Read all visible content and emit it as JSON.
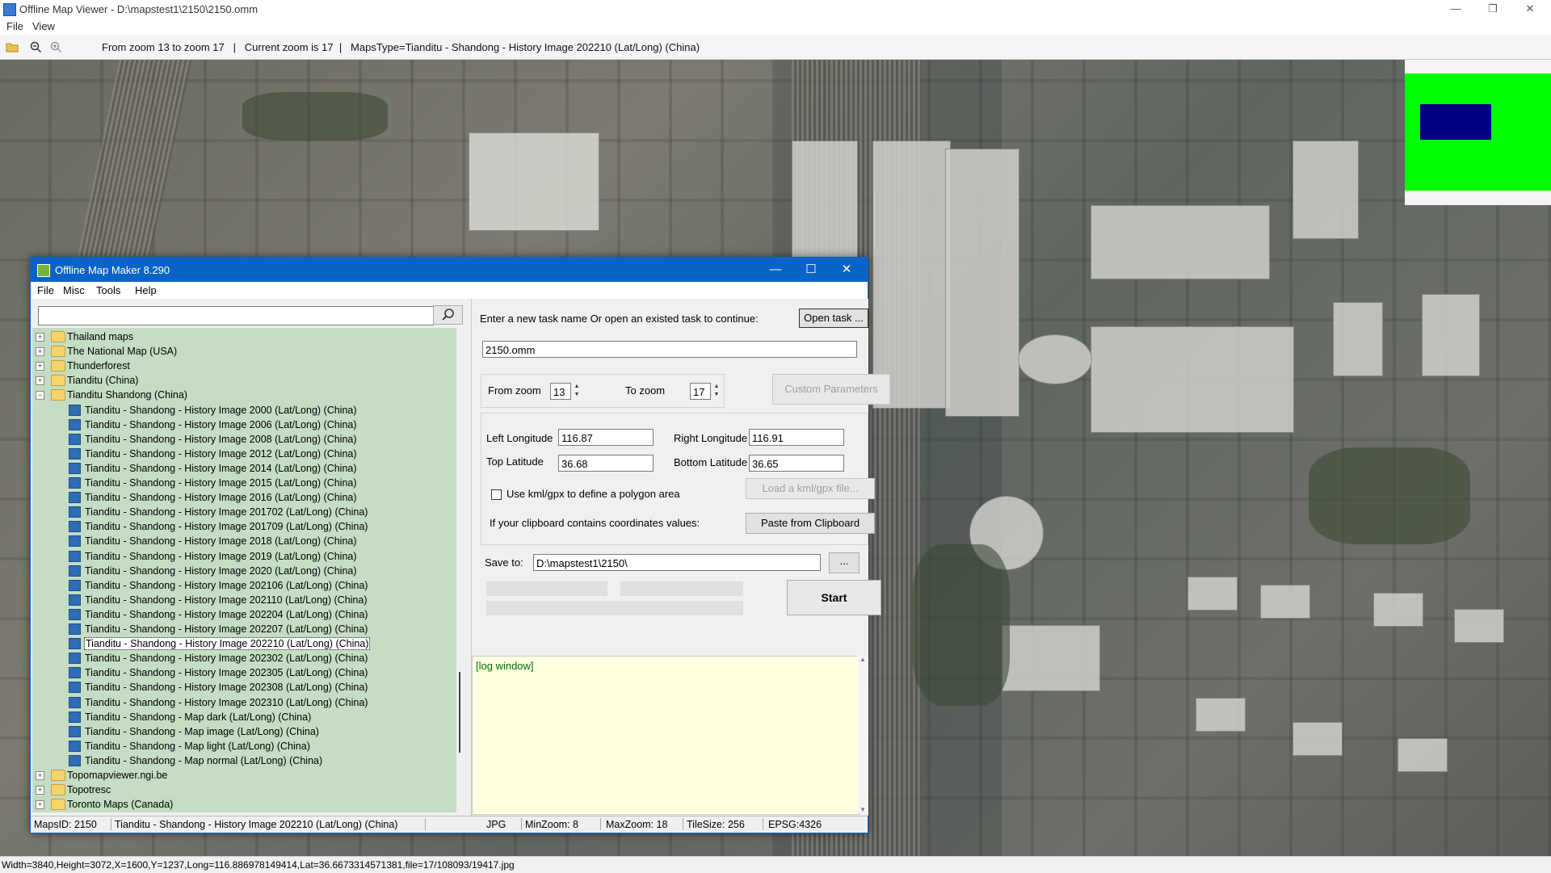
{
  "viewer": {
    "title": "Offline Map Viewer - D:\\mapstest1\\2150\\2150.omm",
    "window_controls": [
      "—",
      "❐",
      "✕"
    ],
    "menu": [
      "File",
      "View"
    ],
    "toolbar_info": "From zoom 13 to zoom 17   |   Current zoom is 17  |   MapsType=Tianditu - Shandong - History Image 202210 (Lat/Long) (China)",
    "status": "Width=3840,Height=3072,X=1600,Y=1237,Long=116.886978149414,Lat=36.6673314571381,file=17/108093/19417.jpg",
    "overview_colors": {
      "frame": "#00ff00",
      "viewport": "#000080"
    }
  },
  "dialog": {
    "title": "Offline Map Maker 8.290",
    "window_controls": [
      "—",
      "☐",
      "✕"
    ],
    "menu": [
      "File",
      "Misc",
      "Tools",
      "Help"
    ],
    "search_value": "",
    "tree": [
      {
        "kind": "folder",
        "label": "Thailand maps",
        "expanded": false
      },
      {
        "kind": "folder",
        "label": "The National Map (USA)",
        "expanded": false
      },
      {
        "kind": "folder",
        "label": "Thunderforest",
        "expanded": false
      },
      {
        "kind": "folder",
        "label": "Tianditu (China)",
        "expanded": false
      },
      {
        "kind": "folder",
        "label": "Tianditu Shandong (China)",
        "expanded": true
      },
      {
        "kind": "map",
        "label": "Tianditu - Shandong - History Image 2000 (Lat/Long) (China)"
      },
      {
        "kind": "map",
        "label": "Tianditu - Shandong - History Image 2006 (Lat/Long) (China)"
      },
      {
        "kind": "map",
        "label": "Tianditu - Shandong - History Image 2008 (Lat/Long) (China)"
      },
      {
        "kind": "map",
        "label": "Tianditu - Shandong - History Image 2012 (Lat/Long) (China)"
      },
      {
        "kind": "map",
        "label": "Tianditu - Shandong - History Image 2014 (Lat/Long) (China)"
      },
      {
        "kind": "map",
        "label": "Tianditu - Shandong - History Image 2015 (Lat/Long) (China)"
      },
      {
        "kind": "map",
        "label": "Tianditu - Shandong - History Image 2016 (Lat/Long) (China)"
      },
      {
        "kind": "map",
        "label": "Tianditu - Shandong - History Image 201702 (Lat/Long) (China)"
      },
      {
        "kind": "map",
        "label": "Tianditu - Shandong - History Image 201709 (Lat/Long) (China)"
      },
      {
        "kind": "map",
        "label": "Tianditu - Shandong - History Image 2018 (Lat/Long) (China)"
      },
      {
        "kind": "map",
        "label": "Tianditu - Shandong - History Image 2019 (Lat/Long) (China)"
      },
      {
        "kind": "map",
        "label": "Tianditu - Shandong - History Image 2020 (Lat/Long) (China)"
      },
      {
        "kind": "map",
        "label": "Tianditu - Shandong - History Image 202106 (Lat/Long) (China)"
      },
      {
        "kind": "map",
        "label": "Tianditu - Shandong - History Image 202110 (Lat/Long) (China)"
      },
      {
        "kind": "map",
        "label": "Tianditu - Shandong - History Image 202204 (Lat/Long) (China)"
      },
      {
        "kind": "map",
        "label": "Tianditu - Shandong - History Image 202207 (Lat/Long) (China)"
      },
      {
        "kind": "map",
        "label": "Tianditu - Shandong - History Image 202210 (Lat/Long) (China)",
        "selected": true
      },
      {
        "kind": "map",
        "label": "Tianditu - Shandong - History Image 202302 (Lat/Long) (China)"
      },
      {
        "kind": "map",
        "label": "Tianditu - Shandong - History Image 202305 (Lat/Long) (China)"
      },
      {
        "kind": "map",
        "label": "Tianditu - Shandong - History Image 202308 (Lat/Long) (China)"
      },
      {
        "kind": "map",
        "label": "Tianditu - Shandong - History Image 202310 (Lat/Long) (China)"
      },
      {
        "kind": "map",
        "label": "Tianditu - Shandong - Map dark (Lat/Long) (China)"
      },
      {
        "kind": "map",
        "label": "Tianditu - Shandong - Map image (Lat/Long) (China)"
      },
      {
        "kind": "map",
        "label": "Tianditu - Shandong - Map light (Lat/Long) (China)"
      },
      {
        "kind": "map",
        "label": "Tianditu - Shandong - Map normal (Lat/Long) (China)"
      },
      {
        "kind": "folder",
        "label": "Topomapviewer.ngi.be",
        "expanded": false
      },
      {
        "kind": "folder",
        "label": "Topotresc",
        "expanded": false
      },
      {
        "kind": "folder",
        "label": "Toronto Maps (Canada)",
        "expanded": false
      }
    ],
    "task_prompt": "Enter a new task name Or open an existed task to continue:",
    "open_task_label": "Open task ...",
    "task_name": "2150.omm",
    "from_zoom_label": "From zoom",
    "from_zoom": "13",
    "to_zoom_label": "To zoom",
    "to_zoom": "17",
    "custom_params_label": "Custom Parameters",
    "left_lon_label": "Left Longitude",
    "left_lon": "116.87",
    "right_lon_label": "Right Longitude",
    "right_lon": "116.91",
    "top_lat_label": "Top Latitude",
    "top_lat": "36.68",
    "bottom_lat_label": "Bottom Latitude",
    "bottom_lat": "36.65",
    "kml_label": "Use kml/gpx to define a polygon area",
    "kml_checked": false,
    "load_kml_label": "Load a kml/gpx file...",
    "clipboard_prompt": "If your clipboard contains coordinates values:",
    "paste_label": "Paste from Clipboard",
    "save_to_label": "Save to:",
    "save_to": "D:\\mapstest1\\2150\\",
    "browse_label": "...",
    "start_label": "Start",
    "log_text": "[log window]",
    "status": {
      "maps_id": "MapsID: 2150",
      "map_name": "Tianditu - Shandong - History Image 202210 (Lat/Long) (China)",
      "format": "JPG",
      "min_zoom": "MinZoom: 8",
      "max_zoom": "MaxZoom: 18",
      "tile_size": "TileSize: 256",
      "epsg": "EPSG:4326"
    }
  }
}
